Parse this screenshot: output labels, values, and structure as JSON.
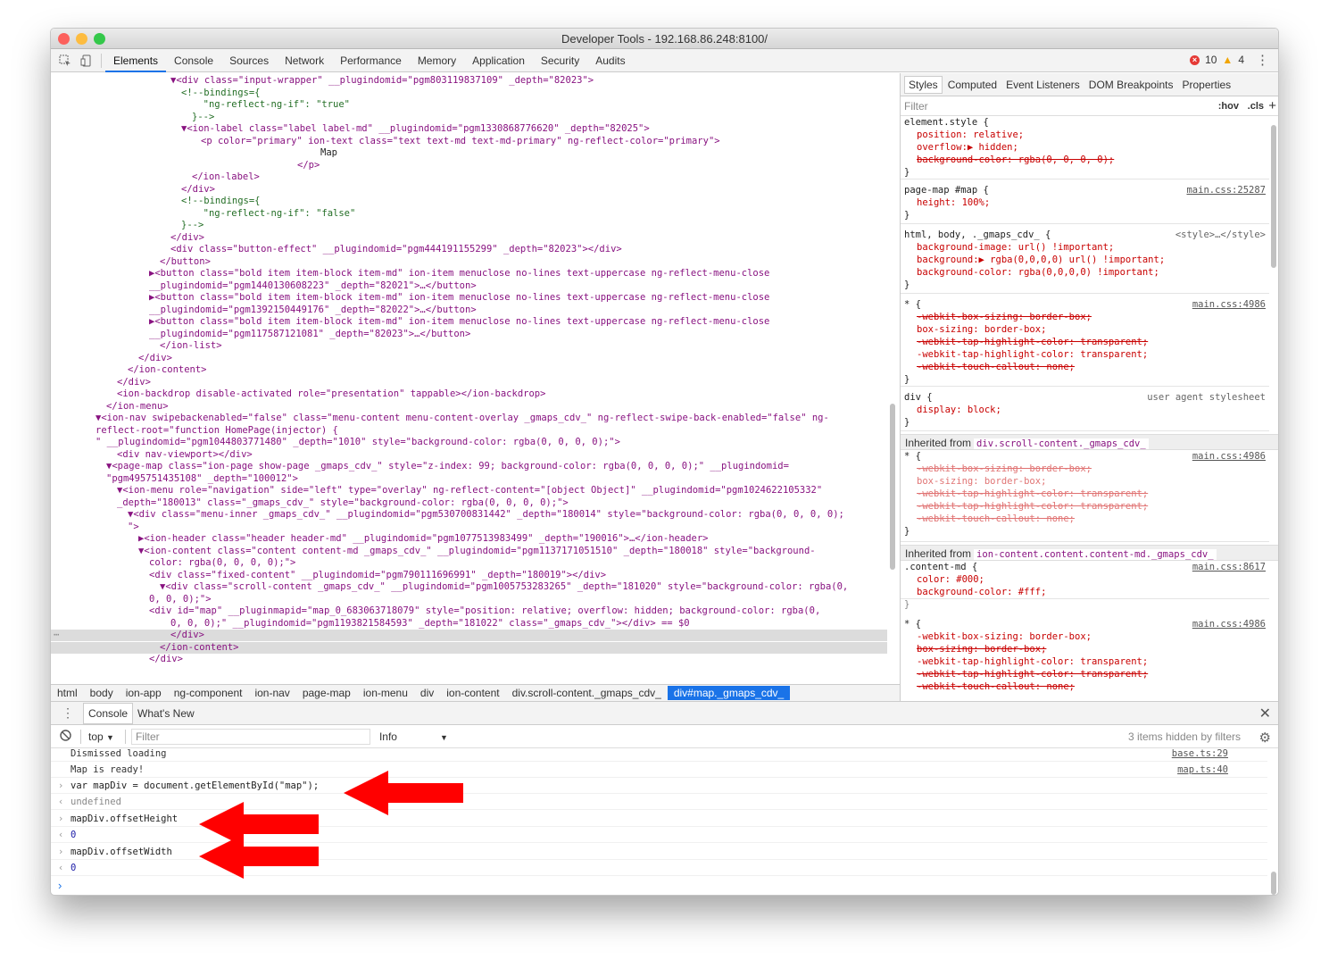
{
  "window": {
    "title": "Developer Tools - 192.168.86.248:8100/"
  },
  "toolbar": {
    "tabs": [
      "Elements",
      "Console",
      "Sources",
      "Network",
      "Performance",
      "Memory",
      "Application",
      "Security",
      "Audits"
    ],
    "active_tab": "Elements",
    "errors": "10",
    "warnings": "4"
  },
  "elements_lines": [
    "▼<div class=\"input-wrapper\" __plugindomid=\"pgm803119837109\" _depth=\"82023\">",
    "<!--bindings={",
    "  \"ng-reflect-ng-if\": \"true\"",
    "}-->",
    "▼<ion-label class=\"label label-md\" __plugindomid=\"pgm1330868776620\" _depth=\"82025\">",
    "<p color=\"primary\" ion-text class=\"text text-md text-md-primary\" ng-reflect-color=\"primary\">",
    "Map",
    "</p>",
    "</ion-label>",
    "</div>",
    "<!--bindings={",
    "  \"ng-reflect-ng-if\": \"false\"",
    "}-->",
    "</div>",
    "<div class=\"button-effect\" __plugindomid=\"pgm444191155299\" _depth=\"82023\"></div>",
    "</button>",
    "▶<button class=\"bold item item-block item-md\" ion-item menuclose no-lines text-uppercase ng-reflect-menu-close",
    "__plugindomid=\"pgm1440130608223\" _depth=\"82021\">…</button>",
    "▶<button class=\"bold item item-block item-md\" ion-item menuclose no-lines text-uppercase ng-reflect-menu-close",
    "__plugindomid=\"pgm1392150449176\" _depth=\"82022\">…</button>",
    "▶<button class=\"bold item item-block item-md\" ion-item menuclose no-lines text-uppercase ng-reflect-menu-close",
    "__plugindomid=\"pgm117587121081\" _depth=\"82023\">…</button>",
    "</ion-list>",
    "</div>",
    "</ion-content>",
    "</div>",
    "<ion-backdrop disable-activated role=\"presentation\" tappable></ion-backdrop>",
    "</ion-menu>",
    "▼<ion-nav swipebackenabled=\"false\" class=\"menu-content menu-content-overlay _gmaps_cdv_\" ng-reflect-swipe-back-enabled=\"false\" ng-",
    "reflect-root=\"function HomePage(injector) {",
    "\" __plugindomid=\"pgm1044803771480\" _depth=\"1010\" style=\"background-color: rgba(0, 0, 0, 0);\">",
    "<div nav-viewport></div>",
    "▼<page-map class=\"ion-page show-page _gmaps_cdv_\" style=\"z-index: 99; background-color: rgba(0, 0, 0, 0);\" __plugindomid=",
    "\"pgm495751435108\" _depth=\"100012\">",
    "▼<ion-menu role=\"navigation\" side=\"left\" type=\"overlay\" ng-reflect-content=\"[object Object]\" __plugindomid=\"pgm1024622105332\"",
    "_depth=\"180013\" class=\"_gmaps_cdv_\" style=\"background-color: rgba(0, 0, 0, 0);\">",
    "▼<div class=\"menu-inner _gmaps_cdv_\" __plugindomid=\"pgm530700831442\" _depth=\"180014\" style=\"background-color: rgba(0, 0, 0, 0);",
    "\">",
    "▶<ion-header class=\"header header-md\" __plugindomid=\"pgm1077513983499\" _depth=\"190016\">…</ion-header>",
    "▼<ion-content class=\"content content-md _gmaps_cdv_\" __plugindomid=\"pgm1137171051510\" _depth=\"180018\" style=\"background-",
    "color: rgba(0, 0, 0, 0);\">",
    "<div class=\"fixed-content\" __plugindomid=\"pgm790111696991\" _depth=\"180019\"></div>",
    "▼<div class=\"scroll-content _gmaps_cdv_\" __plugindomid=\"pgm1005753283265\" _depth=\"181020\" style=\"background-color: rgba(0,",
    "0, 0, 0);\">",
    "<div id=\"map\" __pluginmapid=\"map_0_683063718079\" style=\"position: relative; overflow: hidden; background-color: rgba(0,",
    "0, 0, 0);\" __plugindomid=\"pgm1193821584593\" _depth=\"181022\" class=\"_gmaps_cdv_\"></div> == $0",
    "</div>",
    "</ion-content>",
    "</div>"
  ],
  "breadcrumb": [
    "html",
    "body",
    "ion-app",
    "ng-component",
    "ion-nav",
    "page-map",
    "ion-menu",
    "div",
    "ion-content",
    "div.scroll-content._gmaps_cdv_",
    "div#map._gmaps_cdv_"
  ],
  "styles": {
    "tabs": [
      "Styles",
      "Computed",
      "Event Listeners",
      "DOM Breakpoints",
      "Properties"
    ],
    "filter_placeholder": "Filter",
    "hov": ":hov",
    "cls": ".cls",
    "lines": [
      "element.style {",
      "  position: relative;",
      "  overflow:▶ hidden;",
      "  background-color: rgba(0, 0, 0, 0);",
      "}",
      "page-map #map {",
      "  height: 100%;",
      "}",
      "html, body, ._gmaps_cdv_ {",
      "  background-image: url() !important;",
      "  background:▶ rgba(0,0,0,0) url() !important;",
      "  background-color: rgba(0,0,0,0) !important;",
      "}",
      "* {",
      "  -webkit-box-sizing: border-box;",
      "  box-sizing: border-box;",
      "  -webkit-tap-highlight-color: transparent;",
      "  -webkit-tap-highlight-color: transparent;",
      "  -webkit-touch-callout: none;",
      "}",
      "div {",
      "  display: block;",
      "}",
      "* {",
      "  -webkit-box-sizing: border-box;",
      "  box-sizing: border-box;",
      "  -webkit-tap-highlight-color: transparent;",
      "  -webkit-tap-highlight-color: transparent;",
      "  -webkit-touch-callout: none;",
      "}",
      ".content-md {",
      "  color: #000;",
      "  background-color: #fff;",
      "}",
      "* {",
      "  -webkit-box-sizing: border-box;",
      "  box-sizing: border-box;",
      "  -webkit-tap-highlight-color: transparent;",
      "  -webkit-tap-highlight-color: transparent;",
      "  -webkit-touch-callout: none;"
    ],
    "sources": [
      "main.css:25287",
      "<style>…</style>",
      "main.css:4986",
      "user agent stylesheet",
      "main.css:4986",
      "main.css:8617",
      "main.css:4986"
    ],
    "inherited_label": "Inherited from",
    "inherited": [
      "div.scroll-content._gmaps_cdv_",
      "ion-content.content.content-md._gmaps_cdv_"
    ]
  },
  "drawer": {
    "tabs": [
      "Console",
      "What's New"
    ],
    "context": "top",
    "filter_placeholder": "Filter",
    "level": "Info",
    "hidden_text": "3 items hidden by filters",
    "lines": [
      "Dismissed loading",
      "Map is ready!",
      "var mapDiv = document.getElementById(\"map\");",
      "undefined",
      "mapDiv.offsetHeight",
      "0",
      "mapDiv.offsetWidth",
      "0"
    ],
    "links": [
      "base.ts:29",
      "map.ts:40"
    ]
  },
  "colors": {
    "accent": "#1a73e8",
    "arrow": "#ff0000",
    "tag": "#881280",
    "attr": "#994500",
    "value": "#1a1aa6"
  }
}
